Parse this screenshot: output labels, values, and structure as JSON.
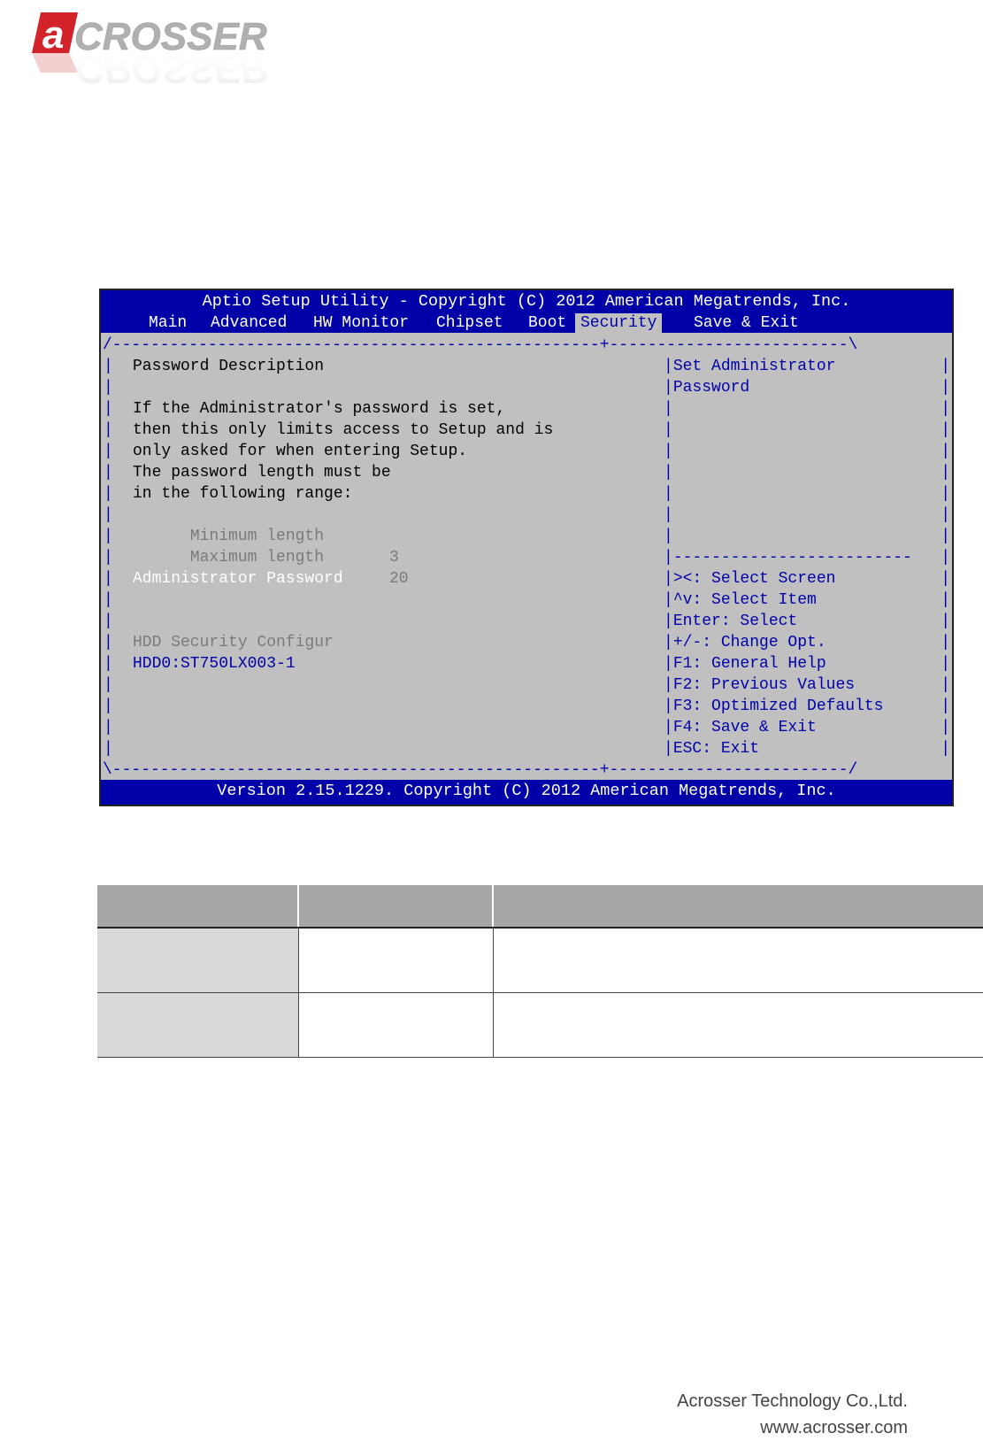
{
  "logo": {
    "text": "ACROSSER",
    "colors": {
      "red": "#d2232a",
      "gray": "#b0b0b0"
    }
  },
  "bios": {
    "title": "Aptio Setup Utility - Copyright (C) 2012 American Megatrends, Inc.",
    "tabs": [
      {
        "label": "Main"
      },
      {
        "label": "Advanced"
      },
      {
        "label": "HW Monitor"
      },
      {
        "label": "Chipset"
      },
      {
        "label": "Boot"
      },
      {
        "label": "Security",
        "active": true
      },
      {
        "label": "Save & Exit"
      }
    ],
    "frame_top": "/---------------------------------------------------+-------------------------\\",
    "frame_bottom": "\\---------------------------------------------------+-------------------------/",
    "left": {
      "heading": "Password Description",
      "desc": [
        "If the Administrator's password is set,",
        "then this only limits access to Setup and is",
        "only asked for when entering Setup.",
        "The password length must be",
        "in the following range:"
      ],
      "min_label": "Minimum length",
      "min_value": "3",
      "max_label": "Maximum length",
      "max_value": "20",
      "admin_password": "Administrator Password",
      "hdd_config": "HDD Security Configur",
      "hdd_item": "HDD0:ST750LX003-1"
    },
    "right": {
      "help_line1": "Set Administrator",
      "help_line2": "Password",
      "separator": "-------------------------",
      "keys": [
        "><: Select Screen",
        "^v: Select Item",
        "Enter: Select",
        "+/-: Change Opt.",
        "F1: General Help",
        "F2: Previous Values",
        "F3: Optimized Defaults",
        "F4: Save & Exit",
        "ESC: Exit"
      ]
    },
    "footer": "Version 2.15.1229. Copyright (C) 2012 American Megatrends, Inc.",
    "colors": {
      "blue": "#0000a8",
      "panel": "#c0c0c0",
      "dim": "#7a7a7a"
    }
  },
  "company": {
    "name": "Acrosser Technology Co.,Ltd.",
    "url": "www.acrosser.com"
  }
}
